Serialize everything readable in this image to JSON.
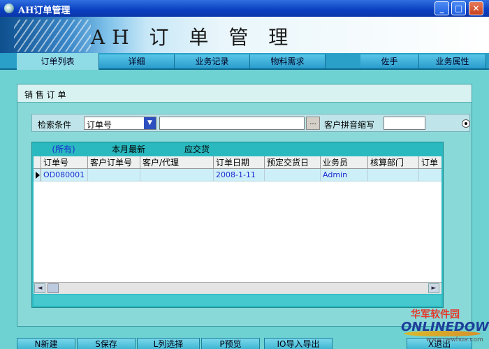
{
  "window": {
    "title": "AH订单管理",
    "minimize": "_",
    "maximize": "□",
    "close": "✕"
  },
  "banner": {
    "title": "AH 订 单 管 理"
  },
  "tabs": [
    {
      "label": "订单列表"
    },
    {
      "label": "详细"
    },
    {
      "label": "业务记录"
    },
    {
      "label": "物料需求"
    },
    {
      "label": "佐手"
    },
    {
      "label": "业务属性"
    }
  ],
  "panel": {
    "title": "销 售 订 单"
  },
  "search": {
    "condition_label": "检索条件",
    "field_value": "订单号",
    "keyword_value": "",
    "browse_label": "...",
    "pinyin_label": "客户拼音缩写",
    "pinyin_value": ""
  },
  "grid": {
    "filters": [
      "(所有)",
      "本月最新",
      "应交货"
    ],
    "columns": [
      "订单号",
      "客户订单号",
      "客户/代理",
      "订单日期",
      "预定交货日",
      "业务员",
      "核算部门",
      "订单"
    ],
    "rows": [
      [
        "OD080001",
        "",
        "",
        "2008-1-11",
        "",
        "Admin",
        "",
        ""
      ]
    ],
    "scroll_left": "◄",
    "scroll_right": "►"
  },
  "actions": [
    {
      "label": "N新建"
    },
    {
      "label": "S保存"
    },
    {
      "label": "L列选择"
    },
    {
      "label": "P预览"
    },
    {
      "label": "IO导入导出"
    },
    {
      "label": "X退出"
    }
  ],
  "watermark": {
    "cn": "华军软件园",
    "en": "ONLINEDOWN",
    "url": "www.newhua.com"
  },
  "colors": {
    "titlebar": "#0a3fc0",
    "background": "#6fd2d2",
    "tabbar": "#2aa0c8",
    "link_text": "#1a2ad0"
  }
}
